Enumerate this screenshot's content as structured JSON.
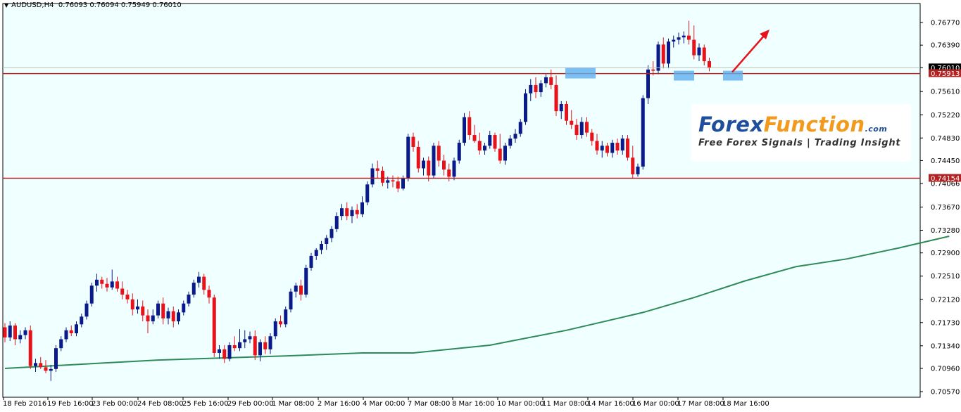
{
  "header": {
    "symbol": "AUDUSD,H4",
    "ohlc": "0.76093 0.76094 0.75949 0.76010"
  },
  "logo": {
    "forex": "Forex",
    "function": "Function",
    "dotcom": ".com",
    "tagline": "Free Forex Signals | Trading Insight"
  },
  "colors": {
    "background": "#f0ffff",
    "bull": "#0b1a8a",
    "bear": "#e8121b",
    "ma": "#2e8b57",
    "hline": "#b22222",
    "highlight": "#5fb0f0",
    "arrow": "#e8121b",
    "current_price": "#c0c0c0"
  },
  "chart_data": {
    "type": "candlestick",
    "symbol": "AUDUSD",
    "timeframe": "H4",
    "y_range": [
      0.7057,
      0.7715
    ],
    "y_ticks": [
      "0.76770",
      "0.76390",
      "0.76010",
      "0.75610",
      "0.75220",
      "0.74830",
      "0.74450",
      "0.74066",
      "0.73670",
      "0.73280",
      "0.72900",
      "0.72510",
      "0.72120",
      "0.71730",
      "0.71340",
      "0.70960",
      "0.70570"
    ],
    "x_labels": [
      "18 Feb 2016",
      "19 Feb 16:00",
      "23 Feb 00:00",
      "24 Feb 08:00",
      "25 Feb 16:00",
      "29 Feb 00:00",
      "1 Mar 08:00",
      "2 Mar 16:00",
      "4 Mar 00:00",
      "7 Mar 08:00",
      "8 Mar 16:00",
      "10 Mar 00:00",
      "11 Mar 08:00",
      "14 Mar 16:00",
      "16 Mar 00:00",
      "17 Mar 08:00",
      "18 Mar 16:00"
    ],
    "horizontal_lines": [
      {
        "price": 0.75913,
        "label": "0.75913"
      },
      {
        "price": 0.74154,
        "label": "0.74154"
      }
    ],
    "current_price": {
      "price": 0.7601,
      "label": "0.76010"
    },
    "moving_average": [
      [
        0,
        0.7096
      ],
      [
        30,
        0.711
      ],
      [
        55,
        0.7117
      ],
      [
        70,
        0.7122
      ],
      [
        80,
        0.7122
      ],
      [
        95,
        0.7135
      ],
      [
        110,
        0.716
      ],
      [
        125,
        0.719
      ],
      [
        135,
        0.7215
      ],
      [
        145,
        0.7243
      ],
      [
        155,
        0.7267
      ],
      [
        165,
        0.728
      ],
      [
        175,
        0.7298
      ],
      [
        185,
        0.7318
      ]
    ],
    "candles": [
      {
        "o": 0.7165,
        "h": 0.7172,
        "l": 0.714,
        "c": 0.7148
      },
      {
        "o": 0.7148,
        "h": 0.7175,
        "l": 0.7142,
        "c": 0.7168
      },
      {
        "o": 0.7168,
        "h": 0.7172,
        "l": 0.7135,
        "c": 0.7145
      },
      {
        "o": 0.7145,
        "h": 0.716,
        "l": 0.7138,
        "c": 0.7152
      },
      {
        "o": 0.7152,
        "h": 0.7165,
        "l": 0.7145,
        "c": 0.716
      },
      {
        "o": 0.716,
        "h": 0.7168,
        "l": 0.7095,
        "c": 0.71
      },
      {
        "o": 0.71,
        "h": 0.7112,
        "l": 0.709,
        "c": 0.7105
      },
      {
        "o": 0.7105,
        "h": 0.7115,
        "l": 0.7095,
        "c": 0.7098
      },
      {
        "o": 0.7098,
        "h": 0.711,
        "l": 0.7088,
        "c": 0.7092
      },
      {
        "o": 0.7092,
        "h": 0.7102,
        "l": 0.7075,
        "c": 0.7095
      },
      {
        "o": 0.7095,
        "h": 0.7135,
        "l": 0.709,
        "c": 0.713
      },
      {
        "o": 0.713,
        "h": 0.715,
        "l": 0.7125,
        "c": 0.7145
      },
      {
        "o": 0.7145,
        "h": 0.7165,
        "l": 0.714,
        "c": 0.716
      },
      {
        "o": 0.716,
        "h": 0.7168,
        "l": 0.715,
        "c": 0.7155
      },
      {
        "o": 0.7155,
        "h": 0.7175,
        "l": 0.715,
        "c": 0.717
      },
      {
        "o": 0.717,
        "h": 0.7188,
        "l": 0.7165,
        "c": 0.7183
      },
      {
        "o": 0.7183,
        "h": 0.721,
        "l": 0.7178,
        "c": 0.7205
      },
      {
        "o": 0.7205,
        "h": 0.724,
        "l": 0.72,
        "c": 0.7235
      },
      {
        "o": 0.7235,
        "h": 0.7255,
        "l": 0.7225,
        "c": 0.7245
      },
      {
        "o": 0.7245,
        "h": 0.725,
        "l": 0.723,
        "c": 0.7238
      },
      {
        "o": 0.7238,
        "h": 0.7248,
        "l": 0.7225,
        "c": 0.7232
      },
      {
        "o": 0.7232,
        "h": 0.7262,
        "l": 0.7228,
        "c": 0.7242
      },
      {
        "o": 0.7242,
        "h": 0.725,
        "l": 0.7225,
        "c": 0.723
      },
      {
        "o": 0.723,
        "h": 0.7242,
        "l": 0.7212,
        "c": 0.722
      },
      {
        "o": 0.722,
        "h": 0.7228,
        "l": 0.7205,
        "c": 0.7212
      },
      {
        "o": 0.7212,
        "h": 0.7222,
        "l": 0.7185,
        "c": 0.7195
      },
      {
        "o": 0.7195,
        "h": 0.7212,
        "l": 0.7188,
        "c": 0.72
      },
      {
        "o": 0.72,
        "h": 0.721,
        "l": 0.7175,
        "c": 0.7185
      },
      {
        "o": 0.7185,
        "h": 0.7195,
        "l": 0.7155,
        "c": 0.7175
      },
      {
        "o": 0.7175,
        "h": 0.7195,
        "l": 0.717,
        "c": 0.7185
      },
      {
        "o": 0.7185,
        "h": 0.721,
        "l": 0.718,
        "c": 0.7205
      },
      {
        "o": 0.7205,
        "h": 0.7215,
        "l": 0.717,
        "c": 0.718
      },
      {
        "o": 0.718,
        "h": 0.7198,
        "l": 0.717,
        "c": 0.7192
      },
      {
        "o": 0.7192,
        "h": 0.72,
        "l": 0.7165,
        "c": 0.7175
      },
      {
        "o": 0.7175,
        "h": 0.7195,
        "l": 0.717,
        "c": 0.719
      },
      {
        "o": 0.719,
        "h": 0.721,
        "l": 0.7185,
        "c": 0.7205
      },
      {
        "o": 0.7205,
        "h": 0.7225,
        "l": 0.72,
        "c": 0.722
      },
      {
        "o": 0.722,
        "h": 0.7245,
        "l": 0.7215,
        "c": 0.724
      },
      {
        "o": 0.724,
        "h": 0.7258,
        "l": 0.7232,
        "c": 0.725
      },
      {
        "o": 0.725,
        "h": 0.7255,
        "l": 0.722,
        "c": 0.7228
      },
      {
        "o": 0.7228,
        "h": 0.7235,
        "l": 0.7205,
        "c": 0.7215
      },
      {
        "o": 0.7215,
        "h": 0.722,
        "l": 0.7115,
        "c": 0.7122
      },
      {
        "o": 0.7122,
        "h": 0.7135,
        "l": 0.7112,
        "c": 0.7128
      },
      {
        "o": 0.7128,
        "h": 0.7135,
        "l": 0.7105,
        "c": 0.7112
      },
      {
        "o": 0.7112,
        "h": 0.714,
        "l": 0.7108,
        "c": 0.7135
      },
      {
        "o": 0.7135,
        "h": 0.715,
        "l": 0.7125,
        "c": 0.713
      },
      {
        "o": 0.713,
        "h": 0.7162,
        "l": 0.7125,
        "c": 0.714
      },
      {
        "o": 0.714,
        "h": 0.716,
        "l": 0.713,
        "c": 0.7145
      },
      {
        "o": 0.7145,
        "h": 0.7158,
        "l": 0.7138,
        "c": 0.715
      },
      {
        "o": 0.715,
        "h": 0.716,
        "l": 0.711,
        "c": 0.7118
      },
      {
        "o": 0.7118,
        "h": 0.7145,
        "l": 0.7108,
        "c": 0.714
      },
      {
        "o": 0.714,
        "h": 0.715,
        "l": 0.712,
        "c": 0.7128
      },
      {
        "o": 0.7128,
        "h": 0.7155,
        "l": 0.712,
        "c": 0.715
      },
      {
        "o": 0.715,
        "h": 0.718,
        "l": 0.7145,
        "c": 0.7175
      },
      {
        "o": 0.7175,
        "h": 0.7185,
        "l": 0.7165,
        "c": 0.717
      },
      {
        "o": 0.717,
        "h": 0.72,
        "l": 0.7165,
        "c": 0.7195
      },
      {
        "o": 0.7195,
        "h": 0.723,
        "l": 0.719,
        "c": 0.7225
      },
      {
        "o": 0.7225,
        "h": 0.724,
        "l": 0.7215,
        "c": 0.7235
      },
      {
        "o": 0.7235,
        "h": 0.7245,
        "l": 0.721,
        "c": 0.722
      },
      {
        "o": 0.722,
        "h": 0.727,
        "l": 0.7215,
        "c": 0.7265
      },
      {
        "o": 0.7265,
        "h": 0.729,
        "l": 0.726,
        "c": 0.7285
      },
      {
        "o": 0.7285,
        "h": 0.7298,
        "l": 0.7278,
        "c": 0.7295
      },
      {
        "o": 0.7295,
        "h": 0.731,
        "l": 0.7288,
        "c": 0.7305
      },
      {
        "o": 0.7305,
        "h": 0.732,
        "l": 0.7295,
        "c": 0.7315
      },
      {
        "o": 0.7315,
        "h": 0.7335,
        "l": 0.7308,
        "c": 0.733
      },
      {
        "o": 0.733,
        "h": 0.7358,
        "l": 0.7325,
        "c": 0.7352
      },
      {
        "o": 0.7352,
        "h": 0.7372,
        "l": 0.7345,
        "c": 0.7365
      },
      {
        "o": 0.7365,
        "h": 0.7375,
        "l": 0.7345,
        "c": 0.7352
      },
      {
        "o": 0.7352,
        "h": 0.7368,
        "l": 0.734,
        "c": 0.7362
      },
      {
        "o": 0.7362,
        "h": 0.7372,
        "l": 0.7348,
        "c": 0.7355
      },
      {
        "o": 0.7355,
        "h": 0.7385,
        "l": 0.735,
        "c": 0.7375
      },
      {
        "o": 0.7375,
        "h": 0.741,
        "l": 0.737,
        "c": 0.7405
      },
      {
        "o": 0.7405,
        "h": 0.744,
        "l": 0.74,
        "c": 0.7432
      },
      {
        "o": 0.7432,
        "h": 0.7445,
        "l": 0.7415,
        "c": 0.7428
      },
      {
        "o": 0.7428,
        "h": 0.7435,
        "l": 0.7402,
        "c": 0.7408
      },
      {
        "o": 0.7408,
        "h": 0.7418,
        "l": 0.7398,
        "c": 0.7412
      },
      {
        "o": 0.7412,
        "h": 0.742,
        "l": 0.74,
        "c": 0.741
      },
      {
        "o": 0.741,
        "h": 0.7418,
        "l": 0.7392,
        "c": 0.7398
      },
      {
        "o": 0.7398,
        "h": 0.742,
        "l": 0.7395,
        "c": 0.7415
      },
      {
        "o": 0.7415,
        "h": 0.749,
        "l": 0.741,
        "c": 0.7485
      },
      {
        "o": 0.7485,
        "h": 0.7492,
        "l": 0.746,
        "c": 0.7468
      },
      {
        "o": 0.7468,
        "h": 0.7478,
        "l": 0.7425,
        "c": 0.7432
      },
      {
        "o": 0.7432,
        "h": 0.745,
        "l": 0.742,
        "c": 0.7445
      },
      {
        "o": 0.7445,
        "h": 0.7452,
        "l": 0.741,
        "c": 0.742
      },
      {
        "o": 0.742,
        "h": 0.7475,
        "l": 0.7415,
        "c": 0.747
      },
      {
        "o": 0.747,
        "h": 0.7478,
        "l": 0.7435,
        "c": 0.7445
      },
      {
        "o": 0.7445,
        "h": 0.7455,
        "l": 0.742,
        "c": 0.743
      },
      {
        "o": 0.743,
        "h": 0.744,
        "l": 0.741,
        "c": 0.7418
      },
      {
        "o": 0.7418,
        "h": 0.745,
        "l": 0.7412,
        "c": 0.7445
      },
      {
        "o": 0.7445,
        "h": 0.748,
        "l": 0.744,
        "c": 0.7475
      },
      {
        "o": 0.7475,
        "h": 0.7525,
        "l": 0.747,
        "c": 0.7518
      },
      {
        "o": 0.7518,
        "h": 0.7528,
        "l": 0.748,
        "c": 0.7488
      },
      {
        "o": 0.7488,
        "h": 0.7505,
        "l": 0.7475,
        "c": 0.7478
      },
      {
        "o": 0.7478,
        "h": 0.7492,
        "l": 0.7455,
        "c": 0.7462
      },
      {
        "o": 0.7462,
        "h": 0.7475,
        "l": 0.7455,
        "c": 0.747
      },
      {
        "o": 0.747,
        "h": 0.7495,
        "l": 0.7465,
        "c": 0.7488
      },
      {
        "o": 0.7488,
        "h": 0.7492,
        "l": 0.746,
        "c": 0.7465
      },
      {
        "o": 0.7465,
        "h": 0.749,
        "l": 0.744,
        "c": 0.7445
      },
      {
        "o": 0.7445,
        "h": 0.7475,
        "l": 0.7438,
        "c": 0.747
      },
      {
        "o": 0.747,
        "h": 0.7488,
        "l": 0.7465,
        "c": 0.7482
      },
      {
        "o": 0.7482,
        "h": 0.7498,
        "l": 0.7475,
        "c": 0.749
      },
      {
        "o": 0.749,
        "h": 0.7515,
        "l": 0.7485,
        "c": 0.751
      },
      {
        "o": 0.751,
        "h": 0.7565,
        "l": 0.7505,
        "c": 0.7558
      },
      {
        "o": 0.7558,
        "h": 0.7582,
        "l": 0.7545,
        "c": 0.7572
      },
      {
        "o": 0.7572,
        "h": 0.7585,
        "l": 0.755,
        "c": 0.756
      },
      {
        "o": 0.756,
        "h": 0.758,
        "l": 0.7552,
        "c": 0.7575
      },
      {
        "o": 0.7575,
        "h": 0.759,
        "l": 0.7568,
        "c": 0.7585
      },
      {
        "o": 0.7585,
        "h": 0.7598,
        "l": 0.7565,
        "c": 0.7572
      },
      {
        "o": 0.7572,
        "h": 0.7588,
        "l": 0.752,
        "c": 0.7528
      },
      {
        "o": 0.7528,
        "h": 0.7545,
        "l": 0.7515,
        "c": 0.754
      },
      {
        "o": 0.754,
        "h": 0.7545,
        "l": 0.7505,
        "c": 0.7512
      },
      {
        "o": 0.7512,
        "h": 0.753,
        "l": 0.7498,
        "c": 0.7505
      },
      {
        "o": 0.7505,
        "h": 0.7515,
        "l": 0.748,
        "c": 0.7488
      },
      {
        "o": 0.7488,
        "h": 0.7518,
        "l": 0.7482,
        "c": 0.751
      },
      {
        "o": 0.751,
        "h": 0.7518,
        "l": 0.7485,
        "c": 0.7492
      },
      {
        "o": 0.7492,
        "h": 0.7498,
        "l": 0.747,
        "c": 0.7478
      },
      {
        "o": 0.7478,
        "h": 0.749,
        "l": 0.7455,
        "c": 0.7462
      },
      {
        "o": 0.7462,
        "h": 0.7478,
        "l": 0.745,
        "c": 0.747
      },
      {
        "o": 0.747,
        "h": 0.7475,
        "l": 0.7452,
        "c": 0.7458
      },
      {
        "o": 0.7458,
        "h": 0.748,
        "l": 0.745,
        "c": 0.7475
      },
      {
        "o": 0.7475,
        "h": 0.7482,
        "l": 0.7455,
        "c": 0.7462
      },
      {
        "o": 0.7462,
        "h": 0.7488,
        "l": 0.7455,
        "c": 0.7482
      },
      {
        "o": 0.7482,
        "h": 0.7488,
        "l": 0.7445,
        "c": 0.745
      },
      {
        "o": 0.745,
        "h": 0.747,
        "l": 0.7415,
        "c": 0.7422
      },
      {
        "o": 0.7422,
        "h": 0.744,
        "l": 0.7418,
        "c": 0.7435
      },
      {
        "o": 0.7435,
        "h": 0.7555,
        "l": 0.743,
        "c": 0.755
      },
      {
        "o": 0.755,
        "h": 0.7605,
        "l": 0.754,
        "c": 0.7598
      },
      {
        "o": 0.7598,
        "h": 0.7612,
        "l": 0.7588,
        "c": 0.7596
      },
      {
        "o": 0.7596,
        "h": 0.7645,
        "l": 0.759,
        "c": 0.764
      },
      {
        "o": 0.764,
        "h": 0.7652,
        "l": 0.76,
        "c": 0.7608
      },
      {
        "o": 0.7608,
        "h": 0.765,
        "l": 0.76,
        "c": 0.7645
      },
      {
        "o": 0.7645,
        "h": 0.7655,
        "l": 0.7635,
        "c": 0.7648
      },
      {
        "o": 0.7648,
        "h": 0.766,
        "l": 0.764,
        "c": 0.7652
      },
      {
        "o": 0.7652,
        "h": 0.7662,
        "l": 0.7642,
        "c": 0.7655
      },
      {
        "o": 0.7655,
        "h": 0.768,
        "l": 0.764,
        "c": 0.7648
      },
      {
        "o": 0.7648,
        "h": 0.7672,
        "l": 0.7615,
        "c": 0.7622
      },
      {
        "o": 0.7622,
        "h": 0.7642,
        "l": 0.7612,
        "c": 0.7635
      },
      {
        "o": 0.7635,
        "h": 0.764,
        "l": 0.7605,
        "c": 0.7612
      },
      {
        "o": 0.7612,
        "h": 0.7618,
        "l": 0.7595,
        "c": 0.7601
      }
    ]
  }
}
